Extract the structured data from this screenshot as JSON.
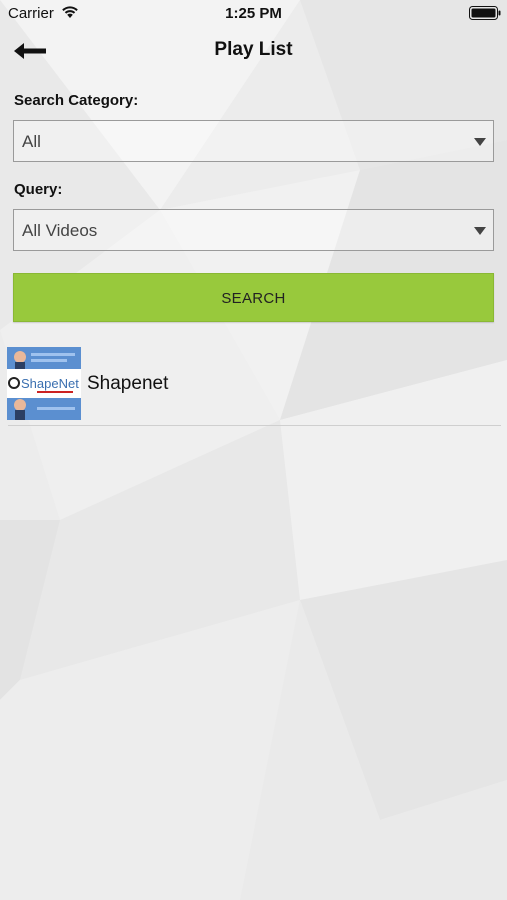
{
  "status_bar": {
    "carrier": "Carrier",
    "time": "1:25 PM"
  },
  "nav": {
    "title": "Play List"
  },
  "form": {
    "category_label": "Search Category:",
    "category_value": "All",
    "query_label": "Query:",
    "query_value": "All Videos",
    "search_button": "SEARCH"
  },
  "playlist": {
    "items": [
      {
        "title": "Shapenet",
        "thumbnail_text": "ShapeNet"
      }
    ]
  },
  "colors": {
    "accent": "#98c93c",
    "background": "#ededed",
    "thumbnail_blue": "#5b8fd0"
  }
}
